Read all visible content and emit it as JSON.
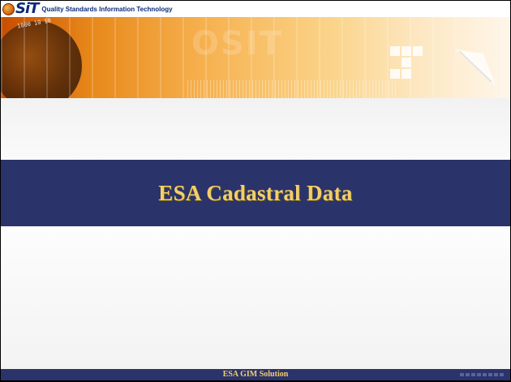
{
  "header": {
    "logo_text": "SiT",
    "tagline": "Quality Standards Information Technology"
  },
  "banner": {
    "watermark": "OSIT",
    "binary_text": "1000 10 10"
  },
  "slide": {
    "title": "ESA Cadastral Data"
  },
  "footer": {
    "label": "ESA GIM Solution"
  },
  "colors": {
    "title_band": "#2b336b",
    "title_text": "#f2cf6a",
    "banner_orange": "#e8891b",
    "logo_blue": "#0b2a7a"
  }
}
